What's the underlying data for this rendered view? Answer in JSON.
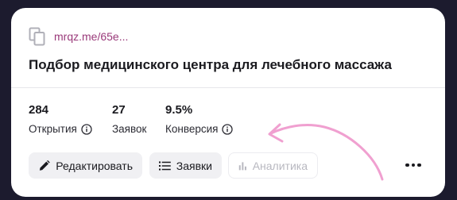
{
  "link": {
    "text": "mrqz.me/65e..."
  },
  "card": {
    "title": "Подбор медицинского центра для лечебного массажа"
  },
  "stats": [
    {
      "value": "284",
      "label": "Открытия",
      "has_info": true
    },
    {
      "value": "27",
      "label": "Заявок",
      "has_info": false
    },
    {
      "value": "9.5%",
      "label": "Конверсия",
      "has_info": true
    }
  ],
  "actions": {
    "edit_label": "Редактировать",
    "leads_label": "Заявки",
    "analytics_label": "Аналитика",
    "analytics_disabled": true,
    "more_icon": "more-dots-icon"
  },
  "icons": [
    "copy-icon",
    "info-icon",
    "pencil-icon",
    "list-icon",
    "bar-chart-icon",
    "more-dots-icon"
  ],
  "colors": {
    "background": "#1c1b2e",
    "card": "#ffffff",
    "link": "#9a3a7a",
    "annotation_arrow": "#f0a0d0",
    "button_bg": "#f0f0f3"
  }
}
